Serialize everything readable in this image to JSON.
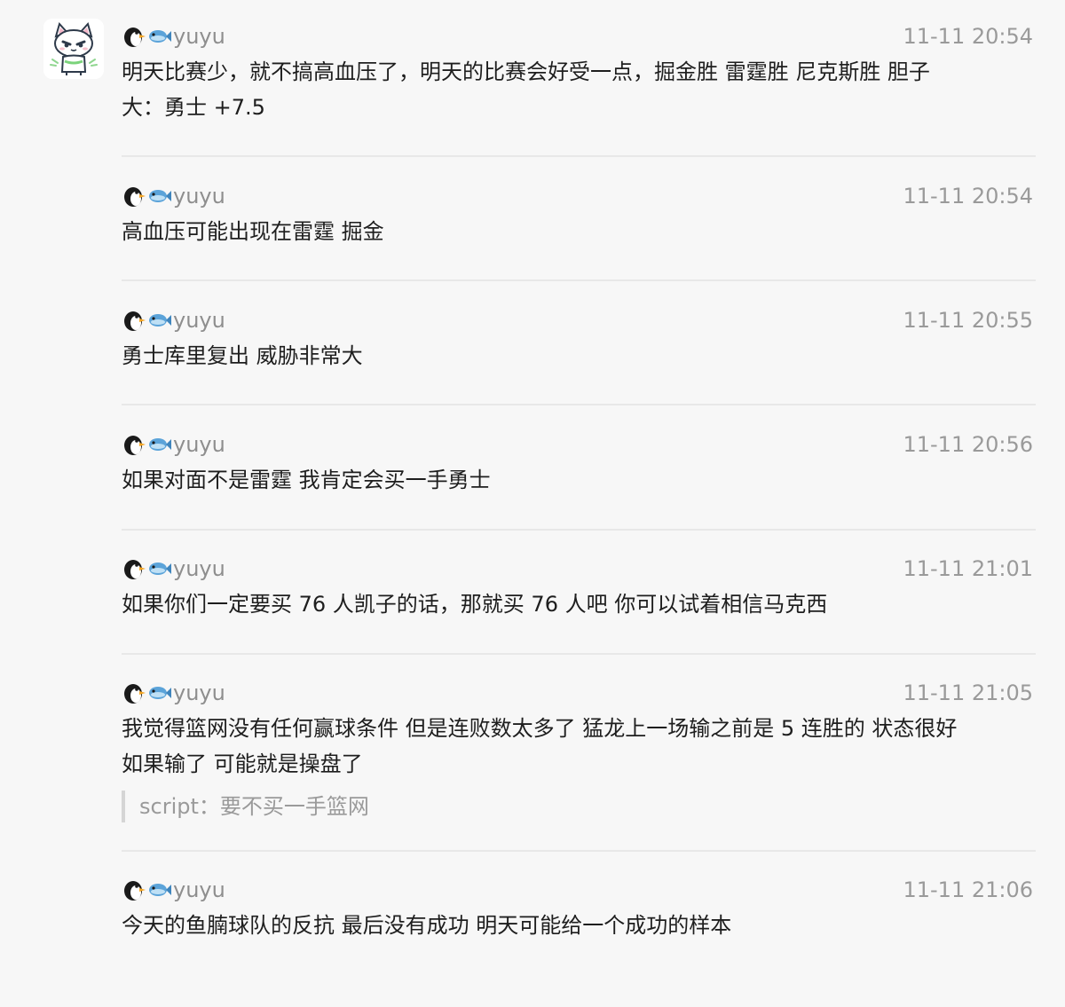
{
  "sender": "yuyu",
  "messages": [
    {
      "time": "11-11 20:54",
      "text": "明天比赛少，就不搞高血压了，明天的比赛会好受一点，掘金胜 雷霆胜 尼克斯胜 胆子\n大：勇士 +7.5"
    },
    {
      "time": "11-11 20:54",
      "text": "高血压可能出现在雷霆 掘金"
    },
    {
      "time": "11-11 20:55",
      "text": "勇士库里复出 威胁非常大"
    },
    {
      "time": "11-11 20:56",
      "text": "如果对面不是雷霆 我肯定会买一手勇士"
    },
    {
      "time": "11-11 21:01",
      "text": "如果你们一定要买 76 人凯子的话，那就买 76 人吧 你可以试着相信马克西"
    },
    {
      "time": "11-11 21:05",
      "text": "我觉得篮网没有任何赢球条件 但是连败数太多了 猛龙上一场输之前是 5 连胜的 状态很好\n如果输了 可能就是操盘了",
      "quote": "script：要不买一手篮网"
    },
    {
      "time": "11-11 21:06",
      "text": "今天的鱼腩球队的反抗 最后没有成功 明天可能给一个成功的样本"
    }
  ],
  "icons": {
    "avatar": "cat-avatar-icon",
    "sender_emoji_1": "penguin-icon",
    "sender_emoji_2": "fish-icon"
  },
  "colors": {
    "background": "#f7f7f7",
    "text": "#1e1e1e",
    "meta": "#8e8e8e",
    "divider": "#e8e8e8",
    "quote_bar": "#d5d5d5"
  }
}
